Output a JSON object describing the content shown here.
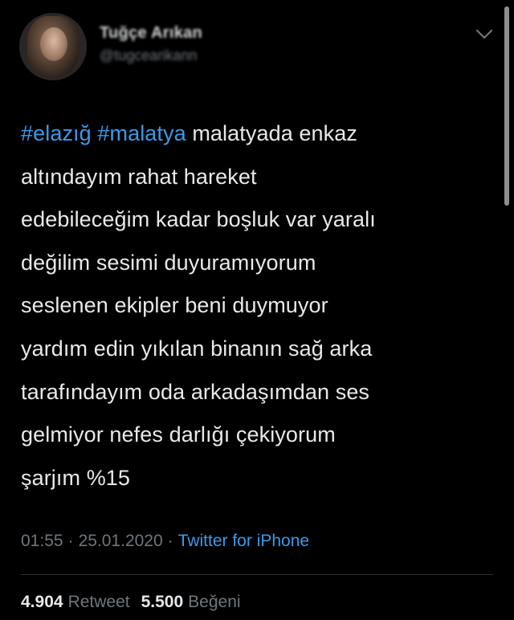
{
  "user": {
    "display_name": "Tuğçe Arıkan",
    "handle": "@tugcearikann"
  },
  "icons": {
    "menu": "chevron-down-icon"
  },
  "tweet": {
    "lines": [
      {
        "hashtag1": "#elazığ",
        "hashtag2": "#malatya",
        "text": " malatyada enkaz"
      },
      "altındayım rahat hareket",
      "edebileceğim kadar boşluk var yaralı",
      "değilim sesimi duyuramıyorum",
      "seslenen ekipler beni duymuyor",
      "yardım edin yıkılan binanın sağ arka",
      "tarafındayım oda arkadaşımdan ses",
      "gelmiyor nefes darlığı çekiyorum",
      "şarjım %15"
    ]
  },
  "meta": {
    "time": "01:55",
    "separator": "·",
    "date": "25.01.2020",
    "source": "Twitter for iPhone"
  },
  "stats": {
    "retweet_count": "4.904",
    "retweet_label": "Retweet",
    "like_count": "5.500",
    "like_label": "Beğeni"
  },
  "colors": {
    "background": "#000000",
    "text": "#e7e9ea",
    "link": "#3b9ae8",
    "muted": "#6e767d"
  }
}
